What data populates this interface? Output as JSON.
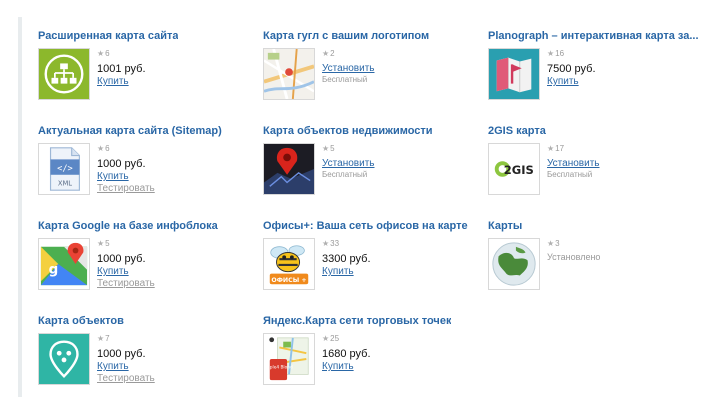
{
  "cards": [
    {
      "title": "Расширенная карта сайта",
      "rating": "6",
      "price": "1001 руб.",
      "primary": "Купить"
    },
    {
      "title": "Карта гугл с вашим логотипом",
      "rating": "2",
      "primary": "Установить",
      "note": "Бесплатный"
    },
    {
      "title": "Planograph – интерактивная карта за...",
      "rating": "16",
      "price": "7500 руб.",
      "primary": "Купить"
    },
    {
      "title": "Актуальная карта сайта (Sitemap)",
      "rating": "6",
      "price": "1000 руб.",
      "primary": "Купить",
      "secondary": "Тестировать"
    },
    {
      "title": "Карта объектов недвижимости",
      "rating": "5",
      "primary": "Установить",
      "note": "Бесплатный"
    },
    {
      "title": "2GIS карта",
      "rating": "17",
      "primary": "Установить",
      "note": "Бесплатный"
    },
    {
      "title": "Карта Google на базе инфоблока",
      "rating": "5",
      "price": "1000 руб.",
      "primary": "Купить",
      "secondary": "Тестировать"
    },
    {
      "title": "Офисы+: Ваша сеть офисов на карте",
      "rating": "33",
      "price": "3300 руб.",
      "primary": "Купить"
    },
    {
      "title": "Карты",
      "rating": "3",
      "status": "Установлено"
    },
    {
      "title": "Карта объектов",
      "rating": "7",
      "price": "1000 руб.",
      "primary": "Купить",
      "secondary": "Тестировать"
    },
    {
      "title": "Яндекс.Карта сети торговых точек",
      "rating": "25",
      "price": "1680 руб.",
      "primary": "Купить"
    }
  ],
  "thumb_text": {
    "xml": "XML",
    "twogis": "2GIS",
    "offices": "ОФИСЫ +",
    "yandex": "Apple4 Blond"
  },
  "icons": [
    "sitemap-icon",
    "google-map-logo-icon",
    "planograph-icon",
    "xml-file-icon",
    "realty-pin-icon",
    "2gis-logo-icon",
    "google-maps-icon",
    "bee-offices-icon",
    "globe-icon",
    "map-pin-icon",
    "yandex-map-icon"
  ],
  "star_glyph": "★"
}
